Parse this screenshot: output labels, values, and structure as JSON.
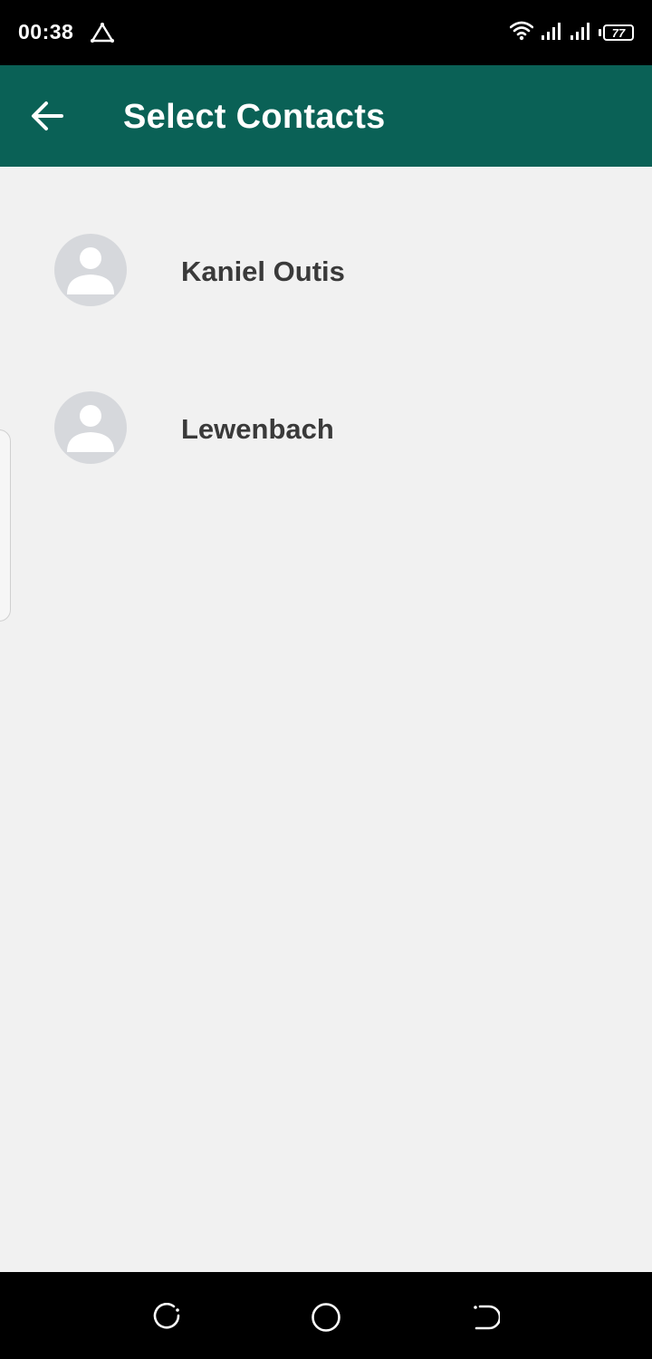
{
  "status_bar": {
    "time": "00:38",
    "battery_level": "77",
    "icons": [
      "alert-triangle-icon",
      "wifi-icon",
      "signal-icon",
      "signal-icon",
      "battery-icon"
    ]
  },
  "app_bar": {
    "title": "Select Contacts",
    "back_icon": "arrow-left-icon",
    "background_color": "#0a6156"
  },
  "contacts": [
    {
      "name": "Kaniel Outis",
      "avatar_icon": "person-placeholder-icon"
    },
    {
      "name": "Lewenbach",
      "avatar_icon": "person-placeholder-icon"
    }
  ],
  "nav_bar": {
    "buttons": [
      "recents-icon",
      "home-icon",
      "back-icon"
    ]
  }
}
